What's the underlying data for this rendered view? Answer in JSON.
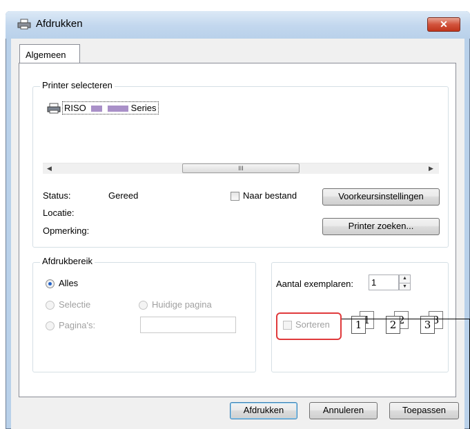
{
  "window": {
    "title": "Afdrukken",
    "close_label": "✕"
  },
  "tabs": [
    {
      "label": "Algemeen"
    }
  ],
  "printer_group": {
    "legend": "Printer selecteren",
    "printers": [
      {
        "name_start": "RISO",
        "name_end": "Series"
      }
    ],
    "scroll_thumb_label": "III",
    "status_label": "Status:",
    "status_value": "Gereed",
    "location_label": "Locatie:",
    "comment_label": "Opmerking:",
    "to_file_label": "Naar bestand",
    "preferences_button": "Voorkeursinstellingen",
    "find_printer_button": "Printer zoeken..."
  },
  "range_group": {
    "legend": "Afdrukbereik",
    "all_label": "Alles",
    "selection_label": "Selectie",
    "current_page_label": "Huidige pagina",
    "pages_label": "Pagina's:",
    "pages_value": ""
  },
  "copies_group": {
    "copies_label": "Aantal exemplaren:",
    "copies_value": "1",
    "collate_label": "Sorteren",
    "collate_pages": [
      "1",
      "1",
      "2",
      "2",
      "3",
      "3"
    ]
  },
  "footer": {
    "print_button": "Afdrukken",
    "cancel_button": "Annuleren",
    "apply_button": "Toepassen"
  },
  "colors": {
    "highlight": "#e0393b",
    "radio_dot": "#2262c8"
  }
}
